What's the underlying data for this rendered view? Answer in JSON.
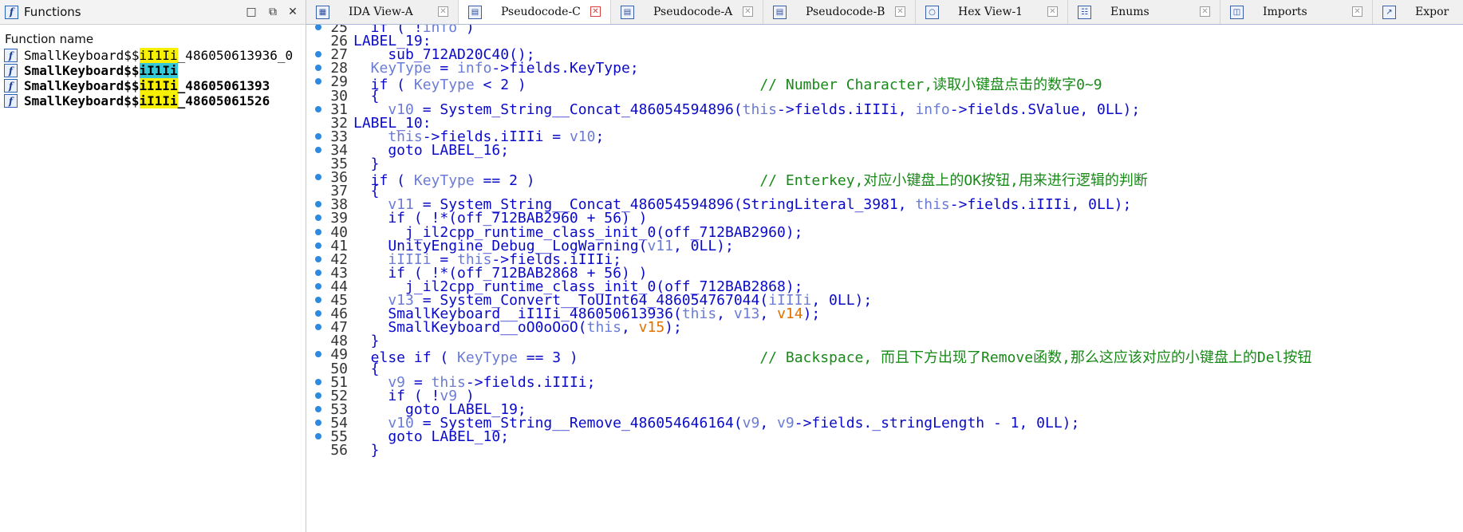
{
  "functions_panel": {
    "title": "Functions",
    "column_header": "Function name",
    "items": [
      {
        "prefix": "SmallKeyboard$$",
        "highlight": "iI1Ii",
        "suffix": "_486050613936_0",
        "bold": false,
        "highlight_color": "yellow"
      },
      {
        "prefix": "SmallKeyboard$$",
        "highlight": "iI1Ii",
        "suffix": "",
        "bold": true,
        "highlight_color": "cyan"
      },
      {
        "prefix": "SmallKeyboard$$",
        "highlight": "iI1Ii",
        "suffix": "_48605061393",
        "bold": true,
        "highlight_color": "yellow"
      },
      {
        "prefix": "SmallKeyboard$$",
        "highlight": "iI1Ii",
        "suffix": "_48605061526",
        "bold": true,
        "highlight_color": "yellow"
      }
    ]
  },
  "tabs": [
    {
      "label": "IDA View-A",
      "active": false,
      "icon": "ida-view-icon"
    },
    {
      "label": "Pseudocode-C",
      "active": true,
      "icon": "pseudocode-icon"
    },
    {
      "label": "Pseudocode-A",
      "active": false,
      "icon": "pseudocode-icon"
    },
    {
      "label": "Pseudocode-B",
      "active": false,
      "icon": "pseudocode-icon"
    },
    {
      "label": "Hex View-1",
      "active": false,
      "icon": "hex-view-icon"
    },
    {
      "label": "Enums",
      "active": false,
      "icon": "enums-icon"
    },
    {
      "label": "Imports",
      "active": false,
      "icon": "imports-icon"
    },
    {
      "label": "Expor",
      "active": false,
      "icon": "exports-icon"
    }
  ],
  "code_lines": [
    {
      "n": "25",
      "dot": true,
      "parts": [
        [
          "k",
          "  if ( !"
        ],
        [
          "v",
          "info"
        ],
        [
          "k",
          " )"
        ]
      ]
    },
    {
      "n": "26",
      "dot": false,
      "parts": [
        [
          "d",
          "LABEL_19:"
        ]
      ]
    },
    {
      "n": "27",
      "dot": true,
      "parts": [
        [
          "k",
          "    sub_712AD20C40();"
        ]
      ]
    },
    {
      "n": "28",
      "dot": true,
      "parts": [
        [
          "v",
          "  KeyType"
        ],
        [
          "k",
          " = "
        ],
        [
          "v",
          "info"
        ],
        [
          "k",
          "->fields.KeyType;"
        ]
      ]
    },
    {
      "n": "29",
      "dot": true,
      "parts": [
        [
          "k",
          "  if ( "
        ],
        [
          "v",
          "KeyType"
        ],
        [
          "k",
          " < 2 )                           "
        ],
        [
          "c",
          "// Number Character,读取小键盘点击的数字0~9"
        ]
      ]
    },
    {
      "n": "30",
      "dot": false,
      "parts": [
        [
          "k",
          "  {"
        ]
      ]
    },
    {
      "n": "31",
      "dot": true,
      "parts": [
        [
          "v",
          "    v10"
        ],
        [
          "k",
          " = System_String__Concat_486054594896("
        ],
        [
          "v",
          "this"
        ],
        [
          "k",
          "->fields.iIIIi, "
        ],
        [
          "v",
          "info"
        ],
        [
          "k",
          "->fields.SValue, 0LL);"
        ]
      ]
    },
    {
      "n": "32",
      "dot": false,
      "parts": [
        [
          "d",
          "LABEL_10:"
        ]
      ]
    },
    {
      "n": "33",
      "dot": true,
      "parts": [
        [
          "v",
          "    this"
        ],
        [
          "k",
          "->fields.iIIIi = "
        ],
        [
          "v",
          "v10"
        ],
        [
          "k",
          ";"
        ]
      ]
    },
    {
      "n": "34",
      "dot": true,
      "parts": [
        [
          "k",
          "    goto LABEL_16;"
        ]
      ]
    },
    {
      "n": "35",
      "dot": false,
      "parts": [
        [
          "k",
          "  }"
        ]
      ]
    },
    {
      "n": "36",
      "dot": true,
      "parts": [
        [
          "k",
          "  if ( "
        ],
        [
          "v",
          "KeyType"
        ],
        [
          "k",
          " == 2 )                          "
        ],
        [
          "c",
          "// Enterkey,对应小键盘上的OK按钮,用来进行逻辑的判断"
        ]
      ]
    },
    {
      "n": "37",
      "dot": false,
      "parts": [
        [
          "k",
          "  {"
        ]
      ]
    },
    {
      "n": "38",
      "dot": true,
      "parts": [
        [
          "v",
          "    v11"
        ],
        [
          "k",
          " = System_String__Concat_486054594896(StringLiteral_3981, "
        ],
        [
          "v",
          "this"
        ],
        [
          "k",
          "->fields.iIIIi, 0LL);"
        ]
      ]
    },
    {
      "n": "39",
      "dot": true,
      "parts": [
        [
          "k",
          "    if ( !*(off_712BAB2960 + 56) )"
        ]
      ]
    },
    {
      "n": "40",
      "dot": true,
      "parts": [
        [
          "k",
          "      j_il2cpp_runtime_class_init_0(off_712BAB2960);"
        ]
      ]
    },
    {
      "n": "41",
      "dot": true,
      "parts": [
        [
          "k",
          "    UnityEngine_Debug__LogWarning("
        ],
        [
          "v",
          "v11"
        ],
        [
          "k",
          ", 0LL);"
        ]
      ]
    },
    {
      "n": "42",
      "dot": true,
      "parts": [
        [
          "v",
          "    iIIIi"
        ],
        [
          "k",
          " = "
        ],
        [
          "v",
          "this"
        ],
        [
          "k",
          "->fields.iIIIi;"
        ]
      ]
    },
    {
      "n": "43",
      "dot": true,
      "parts": [
        [
          "k",
          "    if ( !*(off_712BAB2868 + 56) )"
        ]
      ]
    },
    {
      "n": "44",
      "dot": true,
      "parts": [
        [
          "k",
          "      j_il2cpp_runtime_class_init_0(off_712BAB2868);"
        ]
      ]
    },
    {
      "n": "45",
      "dot": true,
      "parts": [
        [
          "v",
          "    v13"
        ],
        [
          "k",
          " = System_Convert__ToUInt64_486054767044("
        ],
        [
          "v",
          "iIIIi"
        ],
        [
          "k",
          ", 0LL);"
        ]
      ]
    },
    {
      "n": "46",
      "dot": true,
      "parts": [
        [
          "k",
          "    SmallKeyboard__iI1Ii_486050613936("
        ],
        [
          "v",
          "this"
        ],
        [
          "k",
          ", "
        ],
        [
          "v",
          "v13"
        ],
        [
          "k",
          ", "
        ],
        [
          "o",
          "v14"
        ],
        [
          "k",
          ");"
        ]
      ]
    },
    {
      "n": "47",
      "dot": true,
      "parts": [
        [
          "k",
          "    SmallKeyboard__oO0oOoO("
        ],
        [
          "v",
          "this"
        ],
        [
          "k",
          ", "
        ],
        [
          "o",
          "v15"
        ],
        [
          "k",
          ");"
        ]
      ]
    },
    {
      "n": "48",
      "dot": false,
      "parts": [
        [
          "k",
          "  }"
        ]
      ]
    },
    {
      "n": "49",
      "dot": true,
      "parts": [
        [
          "k",
          "  else if ( "
        ],
        [
          "v",
          "KeyType"
        ],
        [
          "k",
          " == 3 )                     "
        ],
        [
          "c",
          "// Backspace, 而且下方出现了Remove函数,那么这应该对应的小键盘上的Del按钮"
        ]
      ]
    },
    {
      "n": "50",
      "dot": false,
      "parts": [
        [
          "k",
          "  {"
        ]
      ]
    },
    {
      "n": "51",
      "dot": true,
      "parts": [
        [
          "v",
          "    v9"
        ],
        [
          "k",
          " = "
        ],
        [
          "v",
          "this"
        ],
        [
          "k",
          "->fields.iIIIi;"
        ]
      ]
    },
    {
      "n": "52",
      "dot": true,
      "parts": [
        [
          "k",
          "    if ( !"
        ],
        [
          "v",
          "v9"
        ],
        [
          "k",
          " )"
        ]
      ]
    },
    {
      "n": "53",
      "dot": true,
      "parts": [
        [
          "k",
          "      goto LABEL_19;"
        ]
      ]
    },
    {
      "n": "54",
      "dot": true,
      "parts": [
        [
          "v",
          "    v10"
        ],
        [
          "k",
          " = System_String__Remove_486054646164("
        ],
        [
          "v",
          "v9"
        ],
        [
          "k",
          ", "
        ],
        [
          "v",
          "v9"
        ],
        [
          "k",
          "->fields._stringLength - 1, 0LL);"
        ]
      ]
    },
    {
      "n": "55",
      "dot": true,
      "parts": [
        [
          "k",
          "    goto LABEL_10;"
        ]
      ]
    },
    {
      "n": "56",
      "dot": false,
      "parts": [
        [
          "k",
          "  }"
        ]
      ]
    }
  ]
}
